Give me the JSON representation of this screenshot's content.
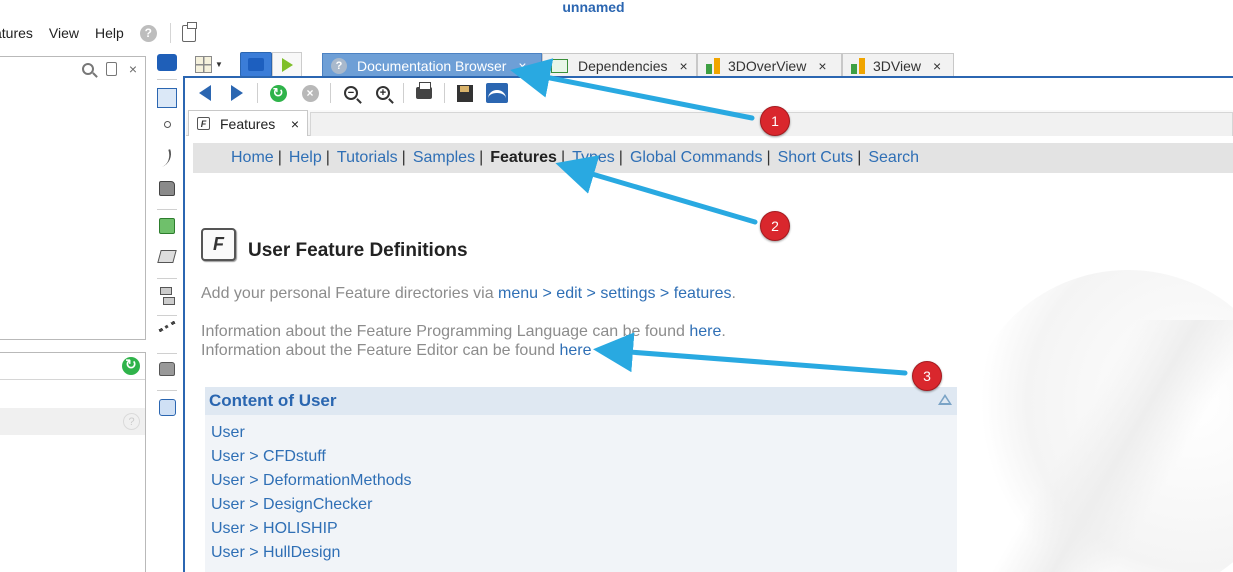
{
  "app": {
    "title": "unnamed"
  },
  "menu": {
    "items": [
      "atures",
      "View",
      "Help"
    ],
    "help_glyph": "?"
  },
  "left_panel_2": {
    "help_glyph": "?"
  },
  "tabs": [
    {
      "label": "Documentation Browser",
      "icon": "help-icon",
      "active": true,
      "close": "×"
    },
    {
      "label": "Dependencies",
      "icon": "dependencies-icon",
      "active": false,
      "close": "×"
    },
    {
      "label": "3DOverView",
      "icon": "bars-icon",
      "active": false,
      "close": "×"
    },
    {
      "label": "3DView",
      "icon": "bars-icon",
      "active": false,
      "close": "×"
    }
  ],
  "doc_tab": {
    "label": "Features",
    "close": "×",
    "icon_glyph": "F"
  },
  "nav": {
    "items": [
      "Home",
      "Help",
      "Tutorials",
      "Samples",
      "Features",
      "Types",
      "Global Commands",
      "Short Cuts",
      "Search"
    ],
    "current": "Features",
    "separator": "|"
  },
  "page": {
    "title": "User Feature Definitions",
    "icon_glyph": "F",
    "line1_prefix": "Add your personal Feature directories via ",
    "line1_link": "menu > edit > settings > features",
    "line1_suffix": ".",
    "line2_prefix": "Information about the Feature Programming Language can be found ",
    "line2_link": "here",
    "line2_suffix": ".",
    "line3_prefix": "Information about the Feature Editor can be found ",
    "line3_link": "here"
  },
  "content_box": {
    "title": "Content of User",
    "items": [
      "User",
      "User > CFDstuff",
      "User > DeformationMethods",
      "User > DesignChecker",
      "User > HOLISHIP",
      "User > HullDesign"
    ]
  },
  "annotations": {
    "badges": [
      "1",
      "2",
      "3"
    ],
    "color": "#d9272d",
    "arrow_color": "#29a9e1"
  },
  "colors": {
    "accent": "#2b66b1",
    "link": "#2f6fb5",
    "active_tab": "#6e9fd6"
  }
}
